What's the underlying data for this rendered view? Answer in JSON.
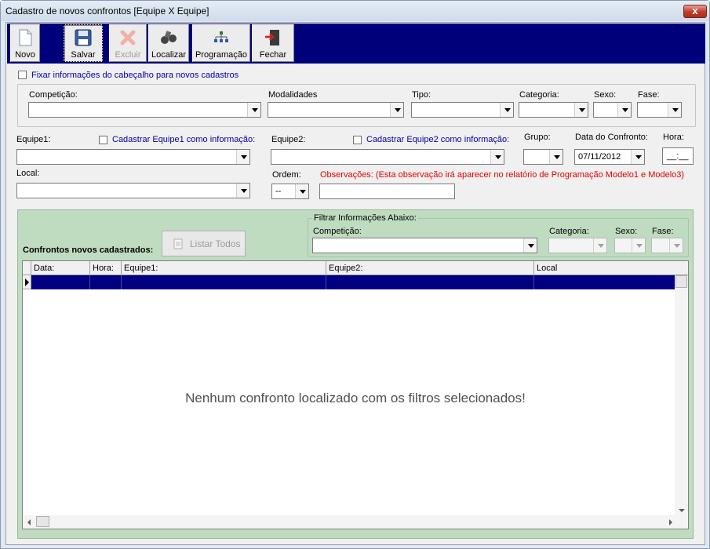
{
  "window": {
    "title": "Cadastro de novos confrontos [Equipe X Equipe]",
    "close_symbol": "x"
  },
  "toolbar": {
    "buttons": [
      {
        "label": "Novo",
        "icon": "new-document-icon"
      },
      {
        "label": "Salvar",
        "icon": "floppy-disk-icon"
      },
      {
        "label": "Excluir",
        "icon": "delete-x-icon"
      },
      {
        "label": "Localizar",
        "icon": "binoculars-icon"
      },
      {
        "label": "Programação",
        "icon": "hierarchy-icon"
      },
      {
        "label": "Fechar",
        "icon": "exit-door-icon"
      }
    ]
  },
  "fix_header": {
    "label": "Fixar informações do cabeçalho para novos cadastros"
  },
  "header_fields": {
    "competicao": "Competição:",
    "modalidades": "Modalidades",
    "tipo": "Tipo:",
    "categoria": "Categoria:",
    "sexo": "Sexo:",
    "fase": "Fase:"
  },
  "match": {
    "equipe1_label": "Equipe1:",
    "equipe1_check": "Cadastrar Equipe1 como informação:",
    "equipe2_label": "Equipe2:",
    "equipe2_check": "Cadastrar Equipe2 como informação:",
    "grupo_label": "Grupo:",
    "data_label": "Data do Confronto:",
    "data_value": "07/11/2012",
    "hora_label": "Hora:",
    "hora_value": "__:__",
    "local_label": "Local:",
    "ordem_label": "Ordem:",
    "ordem_value": "--",
    "obs_label": "Observações: (Esta observação irá aparecer no relatório de Programação Modelo1 e Modelo3)"
  },
  "list": {
    "title": "Confrontos novos cadastrados:",
    "listar_button": "Listar Todos",
    "filter_title": "Filtrar Informações Abaixo:",
    "filter_competicao": "Competição:",
    "filter_categoria": "Categoria:",
    "filter_sexo": "Sexo:",
    "filter_fase": "Fase:",
    "columns": [
      "Data:",
      "Hora:",
      "Equipe1:",
      "Equipe2:",
      "Local"
    ],
    "empty_message": "Nenhum confronto localizado com os filtros selecionados!"
  },
  "colors": {
    "toolbar_bg": "#00007a",
    "selection": "#000080",
    "panel_bg": "#c0dcc0",
    "label_blue": "#0000b0",
    "label_red": "#e00000"
  }
}
